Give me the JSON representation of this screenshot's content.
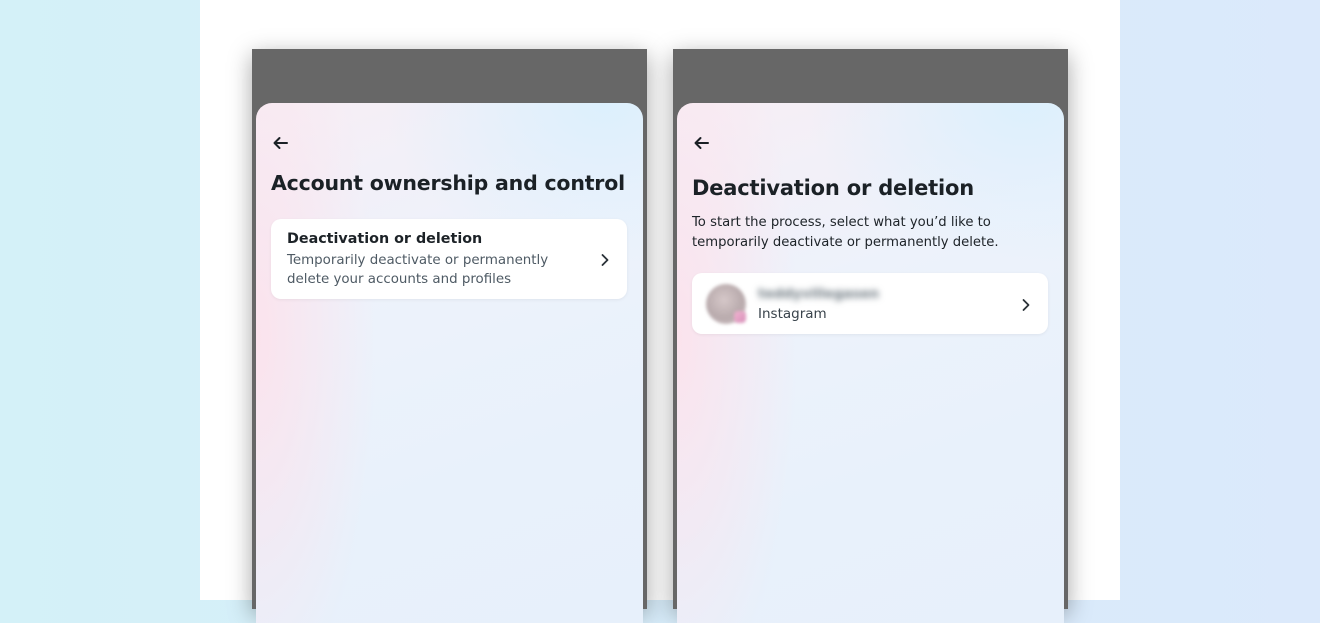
{
  "left_screen": {
    "back_icon": "arrow-left-icon",
    "title": "Account ownership and control",
    "option": {
      "title": "Deactivation or deletion",
      "description": "Temporarily deactivate or permanently delete your accounts and profiles",
      "chevron_icon": "chevron-right-icon"
    }
  },
  "right_screen": {
    "back_icon": "arrow-left-icon",
    "title": "Deactivation or deletion",
    "subtitle": "To start the process, select what you’d like to temporarily deactivate or permanently delete.",
    "account": {
      "username": "teddyvillegasen",
      "platform": "Instagram",
      "avatar_icon": "profile-avatar",
      "chevron_icon": "chevron-right-icon"
    }
  },
  "colors": {
    "page_background": "#d6eefa",
    "panel_background": "#ffffff",
    "phone_frame": "#676767",
    "title_text": "#1b2126",
    "secondary_text": "#4e5a64"
  }
}
